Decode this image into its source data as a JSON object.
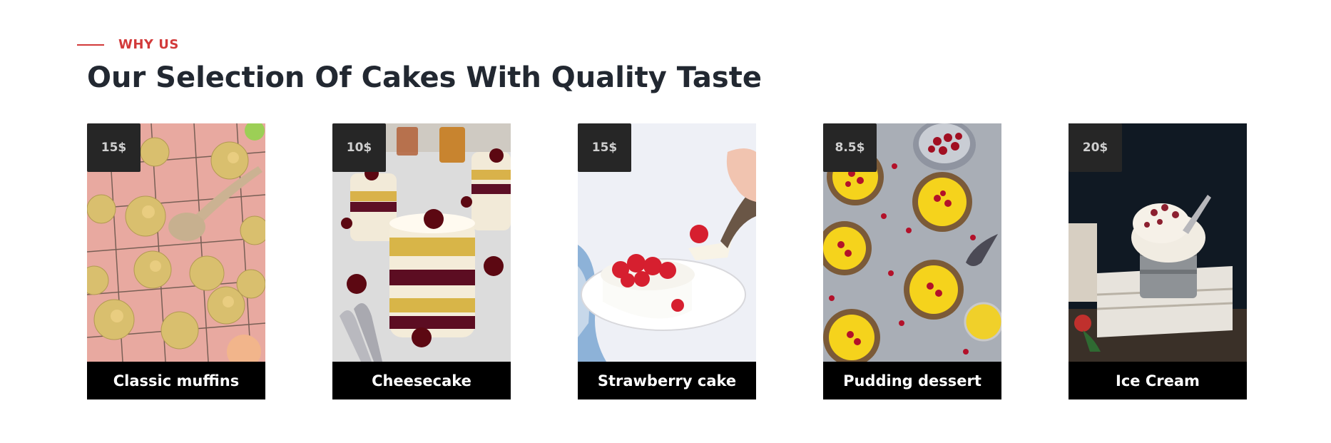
{
  "section": {
    "eyebrow": "WHY US",
    "title": "Our Selection Of Cakes With Quality Taste"
  },
  "colors": {
    "accent": "#d23a3a",
    "title": "#222831",
    "badge_bg": "#262626",
    "caption_bg": "#000000"
  },
  "products": [
    {
      "name": "Classic muffins",
      "price": "15$",
      "image": "muffins-photo"
    },
    {
      "name": "Cheesecake",
      "price": "10$",
      "image": "cheesecake-photo"
    },
    {
      "name": "Strawberry cake",
      "price": "15$",
      "image": "strawberry-cake-photo"
    },
    {
      "name": "Pudding dessert",
      "price": "8.5$",
      "image": "pudding-tarts-photo"
    },
    {
      "name": "Ice Cream",
      "price": "20$",
      "image": "ice-cream-photo"
    }
  ]
}
